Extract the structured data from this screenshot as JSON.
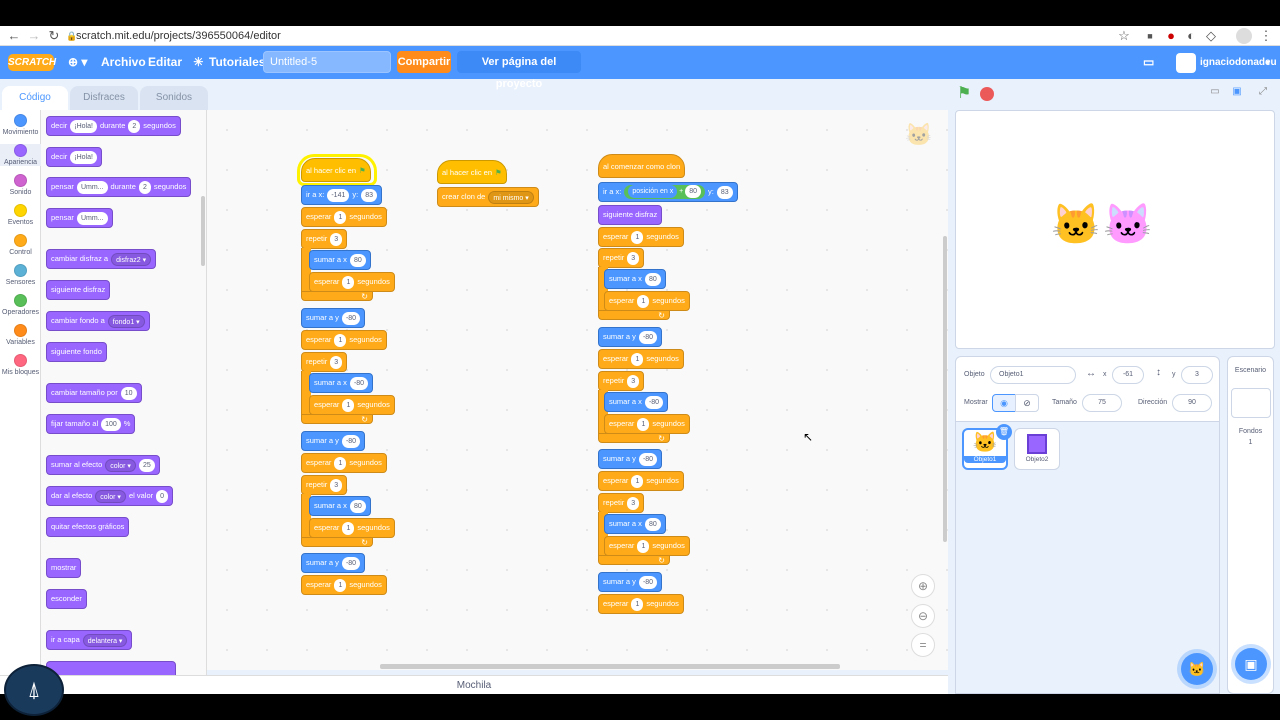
{
  "browser": {
    "url": "scratch.mit.edu/projects/396550064/editor"
  },
  "menubar": {
    "logo": "SCRATCH",
    "file": "Archivo",
    "edit": "Editar",
    "tutorials": "Tutoriales",
    "project_title": "Untitled-5",
    "share": "Compartir",
    "see_project_page": "Ver página del proyecto",
    "username": "ignaciodonadeu"
  },
  "tabs": {
    "code": "Código",
    "costumes": "Disfraces",
    "sounds": "Sonidos"
  },
  "categories": [
    {
      "label": "Movimiento",
      "color": "#4c97ff"
    },
    {
      "label": "Apariencia",
      "color": "#9966ff"
    },
    {
      "label": "Sonido",
      "color": "#cf63cf"
    },
    {
      "label": "Eventos",
      "color": "#ffd500"
    },
    {
      "label": "Control",
      "color": "#ffab19"
    },
    {
      "label": "Sensores",
      "color": "#5cb1d6"
    },
    {
      "label": "Operadores",
      "color": "#59c059"
    },
    {
      "label": "Variables",
      "color": "#ff8c1a"
    },
    {
      "label": "Mis bloques",
      "color": "#ff6680"
    }
  ],
  "palette": {
    "say_for": {
      "a": "decir",
      "v": "¡Hola!",
      "b": "durante",
      "n": "2",
      "c": "segundos"
    },
    "say": {
      "a": "decir",
      "v": "¡Hola!"
    },
    "think_for": {
      "a": "pensar",
      "v": "Umm...",
      "b": "durante",
      "n": "2",
      "c": "segundos"
    },
    "think": {
      "a": "pensar",
      "v": "Umm..."
    },
    "switch_costume": {
      "a": "cambiar disfraz a",
      "v": "disfraz2"
    },
    "next_costume": "siguiente disfraz",
    "switch_backdrop": {
      "a": "cambiar fondo a",
      "v": "fondo1"
    },
    "next_backdrop": "siguiente fondo",
    "change_size": {
      "a": "cambiar tamaño por",
      "v": "10"
    },
    "set_size": {
      "a": "fijar tamaño al",
      "v": "100",
      "b": "%"
    },
    "change_effect": {
      "a": "sumar al efecto",
      "v": "color",
      "n": "25"
    },
    "set_effect": {
      "a": "dar al efecto",
      "v": "color",
      "b": "el valor",
      "n": "0"
    },
    "clear_effects": "quitar efectos gráficos",
    "show": "mostrar",
    "hide": "esconder",
    "go_layer": {
      "a": "ir a capa",
      "v": "delantera"
    }
  },
  "scripts": {
    "s1": {
      "hat": "al hacer clic en",
      "goto": {
        "a": "ir a x:",
        "x": "-141",
        "b": "y:",
        "y": "83"
      },
      "wait": "esperar",
      "one": "1",
      "secs": "segundos",
      "repeat": "repetir",
      "three": "3",
      "changex": "sumar a x",
      "x80": "80",
      "xm80": "-80",
      "changey": "sumar a y",
      "ym80": "-80"
    },
    "s2": {
      "hat": "al hacer clic en",
      "clone": "crear clon de",
      "target": "mi mismo"
    },
    "s3": {
      "hat": "al comenzar como clon",
      "goto": "ir a x:",
      "posx": "posición en x",
      "plus": "+",
      "n80": "80",
      "y": "y:",
      "y83": "83",
      "next": "siguiente disfraz"
    }
  },
  "backpack": "Mochila",
  "sprite_info": {
    "sprite_label": "Objeto",
    "sprite_name": "Objeto1",
    "x_label": "x",
    "x": "-61",
    "y_label": "y",
    "y": "3",
    "show_label": "Mostrar",
    "size_label": "Tamaño",
    "size": "75",
    "direction_label": "Dirección",
    "direction": "90"
  },
  "sprites": [
    {
      "name": "Objeto1"
    },
    {
      "name": "Objeto2"
    }
  ],
  "stage_panel": {
    "title": "Escenario",
    "backdrops_label": "Fondos",
    "backdrops_count": "1"
  }
}
